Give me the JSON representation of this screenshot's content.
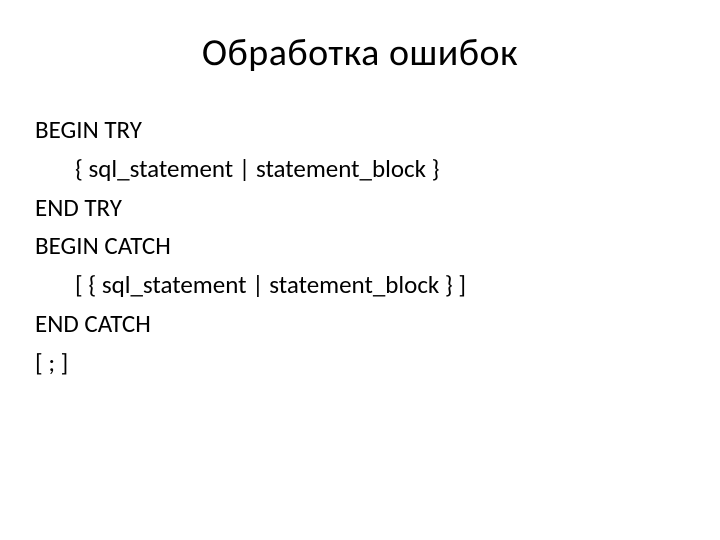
{
  "title": "Обработка ошибок",
  "lines": {
    "l1": "BEGIN TRY",
    "l2": "{ sql_statement | statement_block }",
    "l3": "END TRY",
    "l4": "BEGIN CATCH",
    "l5": "[ { sql_statement | statement_block } ]",
    "l6": "END CATCH",
    "l7": "[ ; ]"
  }
}
